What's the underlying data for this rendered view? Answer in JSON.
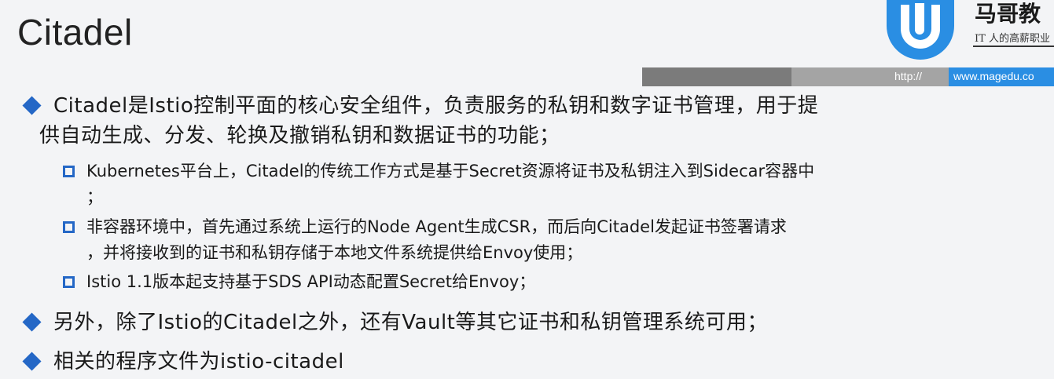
{
  "slide": {
    "title": "Citadel",
    "logo_name": "马哥教",
    "logo_tagline": "IT 人的高薪职业",
    "url_prefix": "http://",
    "url_site": "www.magedu.co",
    "bullets": [
      {
        "lines": [
          "Citadel是Istio控制平面的核心安全组件，负责服务的私钥和数字证书管理，用于提",
          "供自动生成、分发、轮换及撤销私钥和数据证书的功能；"
        ]
      }
    ],
    "subitems": [
      {
        "lines": [
          "Kubernetes平台上，Citadel的传统工作方式是基于Secret资源将证书及私钥注入到Sidecar容器中",
          "；"
        ]
      },
      {
        "lines": [
          "非容器环境中，首先通过系统上运行的Node Agent生成CSR，而后向Citadel发起证书签署请求",
          "，并将接收到的证书和私钥存储于本地文件系统提供给Envoy使用；"
        ]
      },
      {
        "lines": [
          "Istio 1.1版本起支持基于SDS API动态配置Secret给Envoy；"
        ]
      }
    ],
    "bullet2": "另外，除了Istio的Citadel之外，还有Vault等其它证书和私钥管理系统可用；",
    "bullet3": "相关的程序文件为istio-citadel"
  }
}
